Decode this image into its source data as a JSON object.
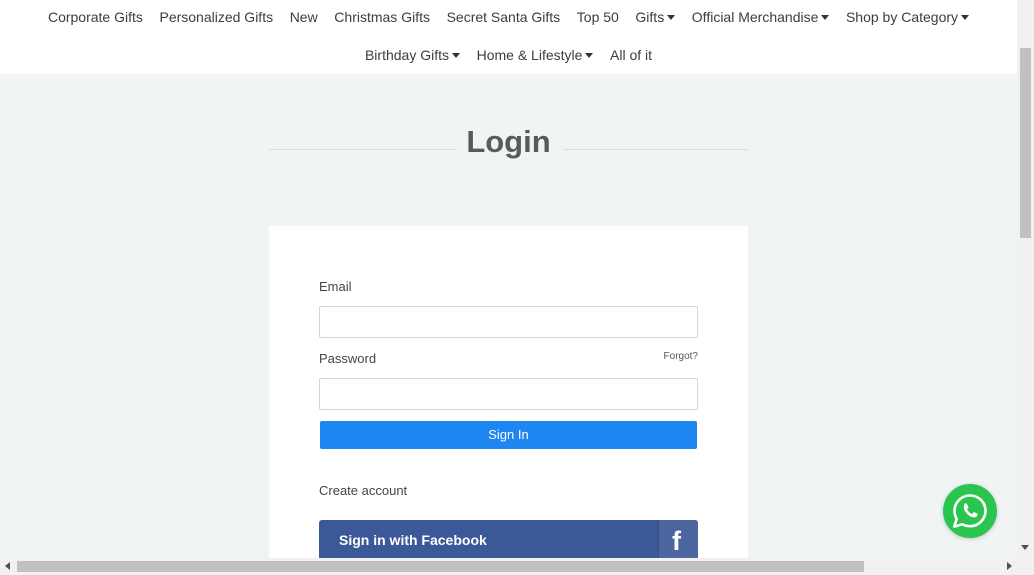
{
  "nav": {
    "row1": [
      {
        "label": "Corporate Gifts",
        "dropdown": false
      },
      {
        "label": "Personalized Gifts",
        "dropdown": false
      },
      {
        "label": "New",
        "dropdown": false
      },
      {
        "label": "Christmas Gifts",
        "dropdown": false
      },
      {
        "label": "Secret Santa Gifts",
        "dropdown": false
      },
      {
        "label": "Top 50",
        "dropdown": false
      },
      {
        "label": "Gifts",
        "dropdown": true
      },
      {
        "label": "Official Merchandise",
        "dropdown": true
      },
      {
        "label": "Shop by Category",
        "dropdown": true
      }
    ],
    "row2": [
      {
        "label": "Birthday Gifts",
        "dropdown": true
      },
      {
        "label": "Home & Lifestyle",
        "dropdown": true
      },
      {
        "label": "All of it",
        "dropdown": false
      }
    ]
  },
  "page": {
    "title": "Login"
  },
  "form": {
    "email_label": "Email",
    "email_value": "",
    "password_label": "Password",
    "password_value": "",
    "forgot_label": "Forgot?",
    "signin_label": "Sign In",
    "create_account_label": "Create account",
    "facebook_label": "Sign in with Facebook",
    "facebook_icon": "facebook-f-icon"
  },
  "floating": {
    "whatsapp_icon": "whatsapp-icon"
  },
  "colors": {
    "primary_button": "#1e86f0",
    "facebook_blue": "#3b5998",
    "whatsapp_green": "#29c54f",
    "page_background": "#f1f4f4"
  }
}
